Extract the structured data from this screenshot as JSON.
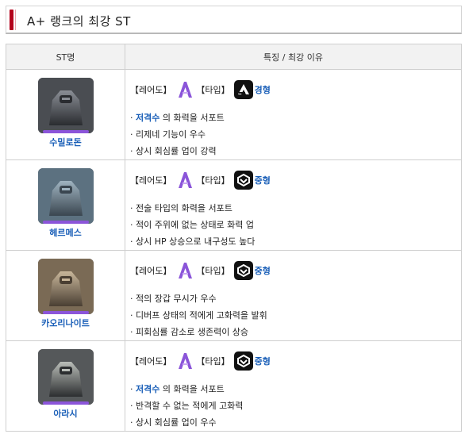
{
  "title": "A+ 랭크의 최강 ST",
  "headers": {
    "name": "ST명",
    "info": "특징 / 최강 이유"
  },
  "labels": {
    "rarity": "【레어도】",
    "type": "【타입】"
  },
  "rows": [
    {
      "name": "수밀로돈",
      "type_name": "경형",
      "type_icon": "light-type-icon",
      "features": [
        {
          "prefix": "· ",
          "highlight": "저격수",
          "rest": " 의 화력을 서포트"
        },
        {
          "prefix": "· ",
          "highlight": "",
          "rest": "리제네 기능이 우수"
        },
        {
          "prefix": "· ",
          "highlight": "",
          "rest": "상시 회심률 업이 강력"
        }
      ]
    },
    {
      "name": "헤르메스",
      "type_name": "중형",
      "type_icon": "medium-type-icon",
      "features": [
        {
          "prefix": "· ",
          "highlight": "",
          "rest": "전술 타입의 화력을 서포트"
        },
        {
          "prefix": "· ",
          "highlight": "",
          "rest": "적이 주위에 없는 상태로 화력 업"
        },
        {
          "prefix": "· ",
          "highlight": "",
          "rest": "상시 HP 상승으로 내구성도 높다"
        }
      ]
    },
    {
      "name": "카오리나이트",
      "type_name": "중형",
      "type_icon": "medium-type-icon",
      "features": [
        {
          "prefix": "· ",
          "highlight": "",
          "rest": "적의 장갑 무시가 우수"
        },
        {
          "prefix": "· ",
          "highlight": "",
          "rest": "디버프 상태의 적에게 고화력을 발휘"
        },
        {
          "prefix": "· ",
          "highlight": "",
          "rest": "피회심률 감소로 생존력이 상승"
        }
      ]
    },
    {
      "name": "아라시",
      "type_name": "중형",
      "type_icon": "medium-type-icon",
      "features": [
        {
          "prefix": "· ",
          "highlight": "저격수",
          "rest": " 의 화력을 서포트"
        },
        {
          "prefix": "· ",
          "highlight": "",
          "rest": "반격할 수 없는 적에게 고화력"
        },
        {
          "prefix": "· ",
          "highlight": "",
          "rest": "상시 회심률 업이 우수"
        }
      ]
    }
  ],
  "colors": {
    "accent": "#b3001b",
    "link_blue": "#1a5fb8",
    "rank_purple": "#8b55d9"
  },
  "icons": {
    "rarity": "rank-a-icon"
  }
}
